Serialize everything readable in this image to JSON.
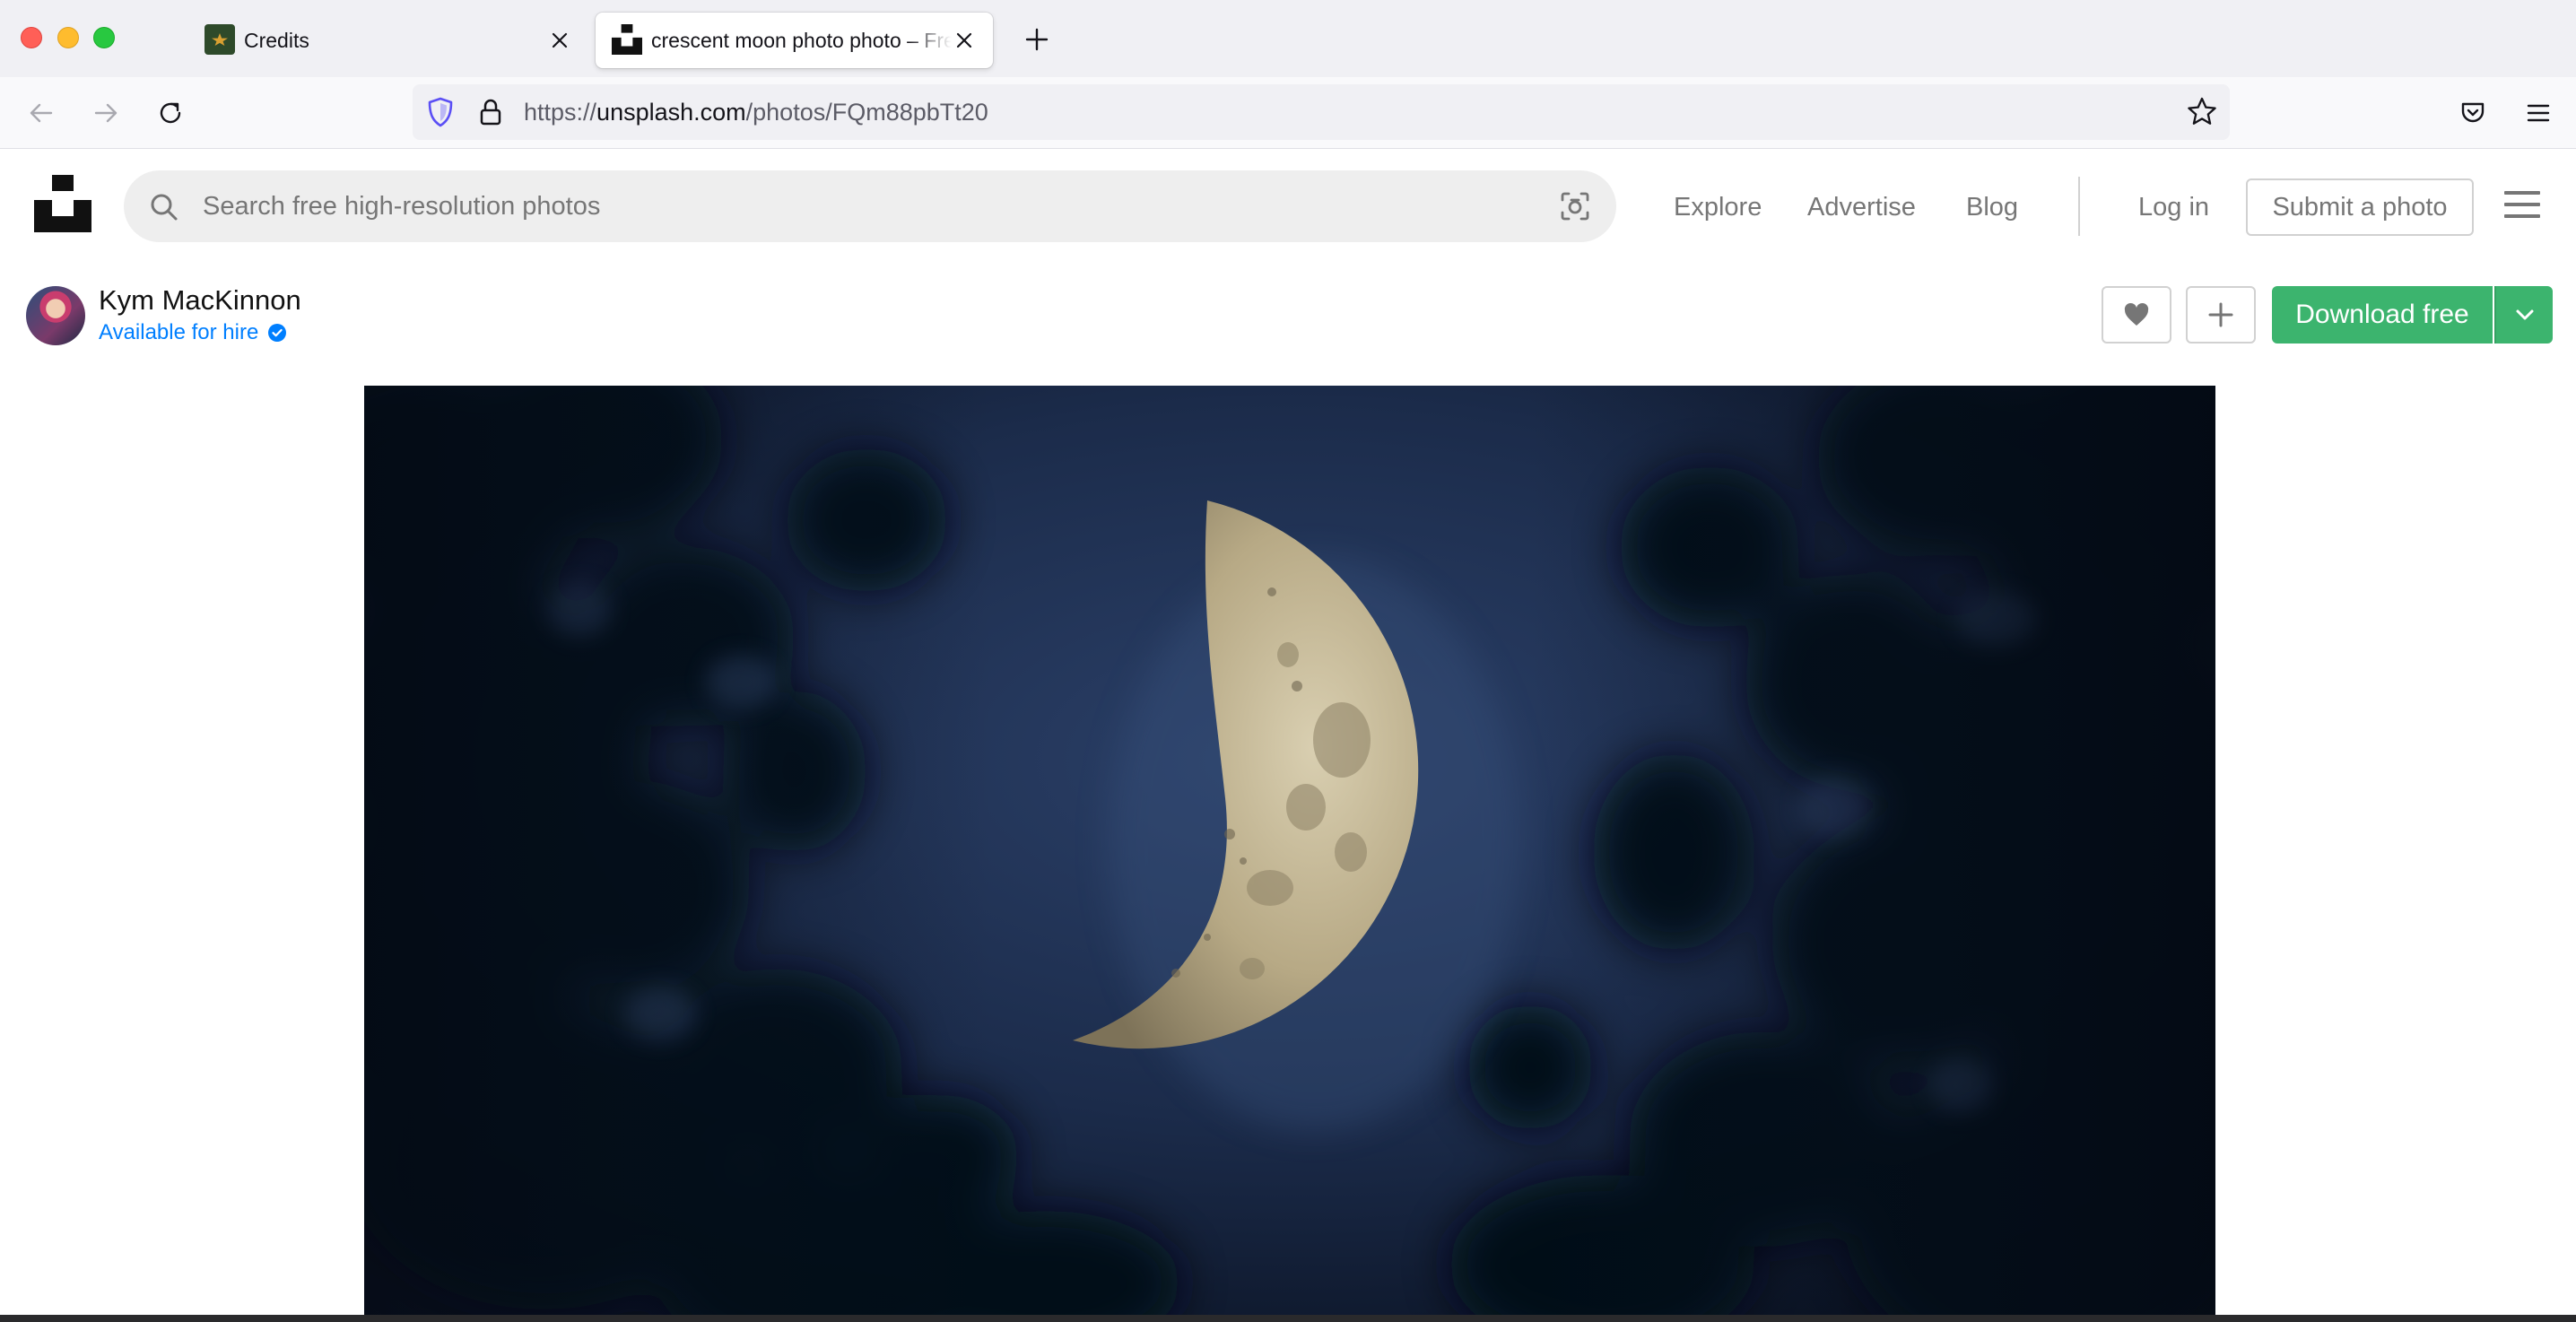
{
  "browser": {
    "tabs": [
      {
        "title": "Credits",
        "active": false
      },
      {
        "title": "crescent moon photo photo – Free",
        "active": true
      }
    ],
    "url_domain": "unsplash.com",
    "url_prefix": "https://",
    "url_path": "/photos/FQm88pbTt20"
  },
  "header": {
    "search_placeholder": "Search free high-resolution photos",
    "nav": [
      {
        "label": "Explore"
      },
      {
        "label": "Advertise"
      },
      {
        "label": "Blog"
      }
    ],
    "login_label": "Log in",
    "submit_label": "Submit a photo"
  },
  "photo_meta": {
    "author_name": "Kym MacKinnon",
    "hire_label": "Available for hire",
    "download_label": "Download free"
  },
  "colors": {
    "accent_green": "#3cb46e",
    "hire_blue": "#007fff",
    "sky_dark": "#0f1a2e"
  },
  "icons": {
    "back": "arrow-left-icon",
    "forward": "arrow-right-icon",
    "reload": "reload-icon",
    "shield": "tracking-shield-icon",
    "lock": "lock-icon",
    "bookmark": "star-icon",
    "pocket": "pocket-icon",
    "app_menu": "hamburger-icon",
    "search": "search-icon",
    "visual_search": "visual-search-icon",
    "like": "heart-icon",
    "collect": "plus-icon",
    "download_options": "chevron-down-icon"
  }
}
